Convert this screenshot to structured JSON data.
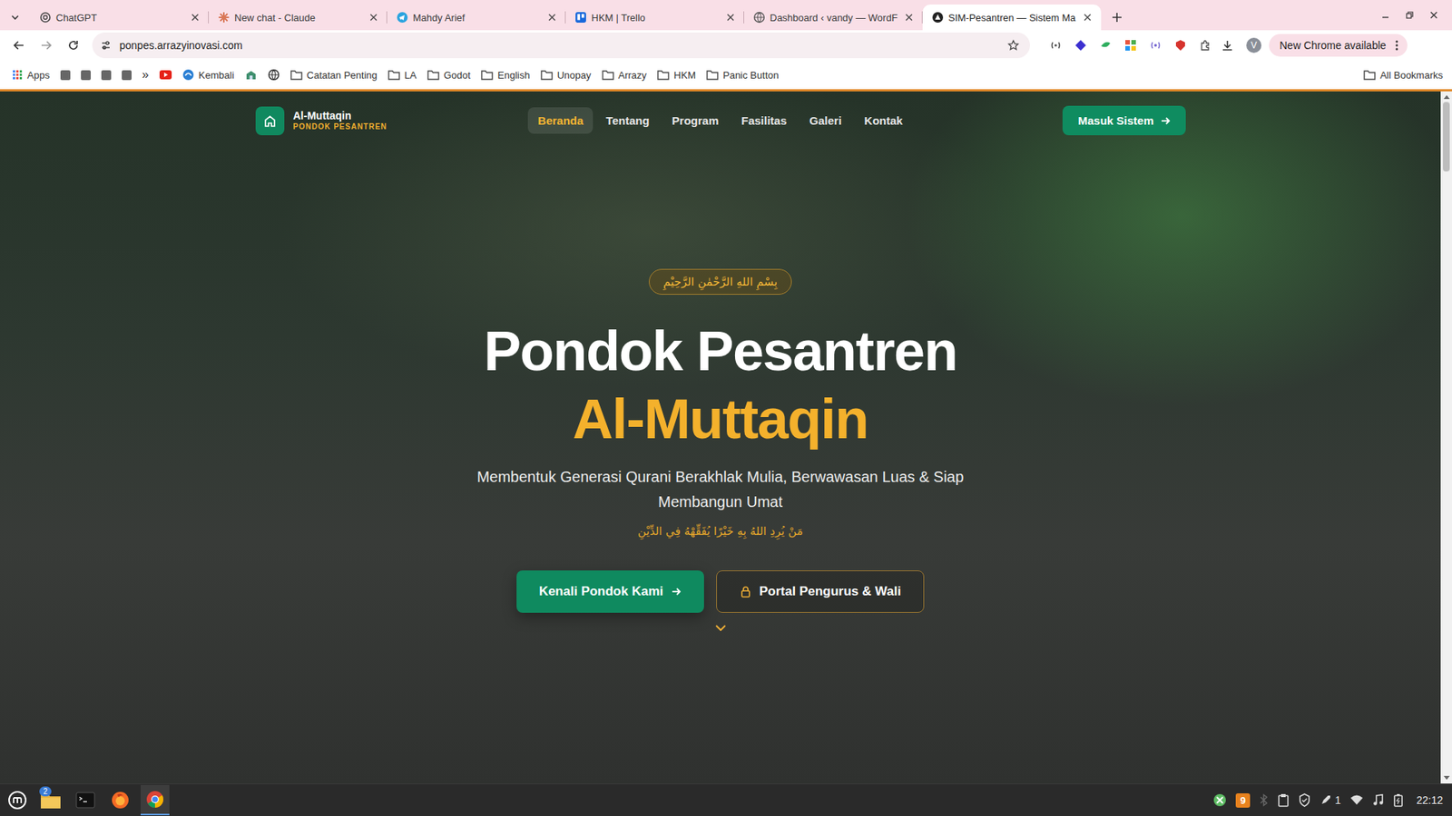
{
  "browser": {
    "tabs": [
      {
        "label": "ChatGPT",
        "kind": "openai",
        "selected": false
      },
      {
        "label": "New chat - Claude",
        "kind": "claude",
        "selected": false
      },
      {
        "label": "Mahdy Arief",
        "kind": "telegram",
        "selected": false
      },
      {
        "label": "HKM | Trello",
        "kind": "trello",
        "selected": false
      },
      {
        "label": "Dashboard ‹ vandy — WordF",
        "kind": "wordpress",
        "selected": false
      },
      {
        "label": "SIM-Pesantren — Sistem Ma",
        "kind": "site",
        "selected": true
      }
    ],
    "address": "ponpes.arrazyinovasi.com",
    "update_button": "New Chrome available",
    "profile": "V",
    "bookmarks_left": [
      {
        "label": "Apps",
        "kind": "apps"
      }
    ],
    "bookmarks_overflow": "»",
    "bookmarks": [
      {
        "label": "Kembali",
        "kind": "link"
      },
      {
        "label": "Catatan Penting",
        "kind": "folder"
      },
      {
        "label": "LA",
        "kind": "folder"
      },
      {
        "label": "Godot",
        "kind": "folder"
      },
      {
        "label": "English",
        "kind": "folder"
      },
      {
        "label": "Unopay",
        "kind": "folder"
      },
      {
        "label": "Arrazy",
        "kind": "folder"
      },
      {
        "label": "HKM",
        "kind": "folder"
      },
      {
        "label": "Panic Button",
        "kind": "folder"
      }
    ],
    "all_bookmarks": "All Bookmarks"
  },
  "page": {
    "brand": {
      "name": "Al-Muttaqin",
      "tagline": "PONDOK PESANTREN"
    },
    "nav": [
      {
        "label": "Beranda",
        "selected": true
      },
      {
        "label": "Tentang",
        "selected": false
      },
      {
        "label": "Program",
        "selected": false
      },
      {
        "label": "Fasilitas",
        "selected": false
      },
      {
        "label": "Galeri",
        "selected": false
      },
      {
        "label": "Kontak",
        "selected": false
      }
    ],
    "login_button": "Masuk Sistem",
    "hero": {
      "badge": "بِسْمِ اللهِ الرَّحْمٰنِ الرَّحِيْمِ",
      "title_line1": "Pondok Pesantren",
      "title_line2": "Al-Muttaqin",
      "subtitle": "Membentuk Generasi Qurani Berakhlak Mulia, Berwawasan Luas & Siap Membangun Umat",
      "quote": "مَنْ يُرِدِ اللهُ بِهِ خَيْرًا يُفَقِّهْهُ فِي الدِّيْنِ",
      "primary_button": "Kenali Pondok Kami",
      "secondary_button": "Portal Pengurus & Wali"
    }
  },
  "taskbar": {
    "apps": [
      {
        "kind": "files",
        "selected": false,
        "badge": "2"
      },
      {
        "kind": "terminal",
        "selected": false,
        "badge": ""
      },
      {
        "kind": "firefox",
        "selected": false,
        "badge": ""
      },
      {
        "kind": "chrome",
        "selected": true,
        "badge": ""
      }
    ],
    "update_count": "9",
    "notification_count": "1",
    "time": "22:12"
  }
}
